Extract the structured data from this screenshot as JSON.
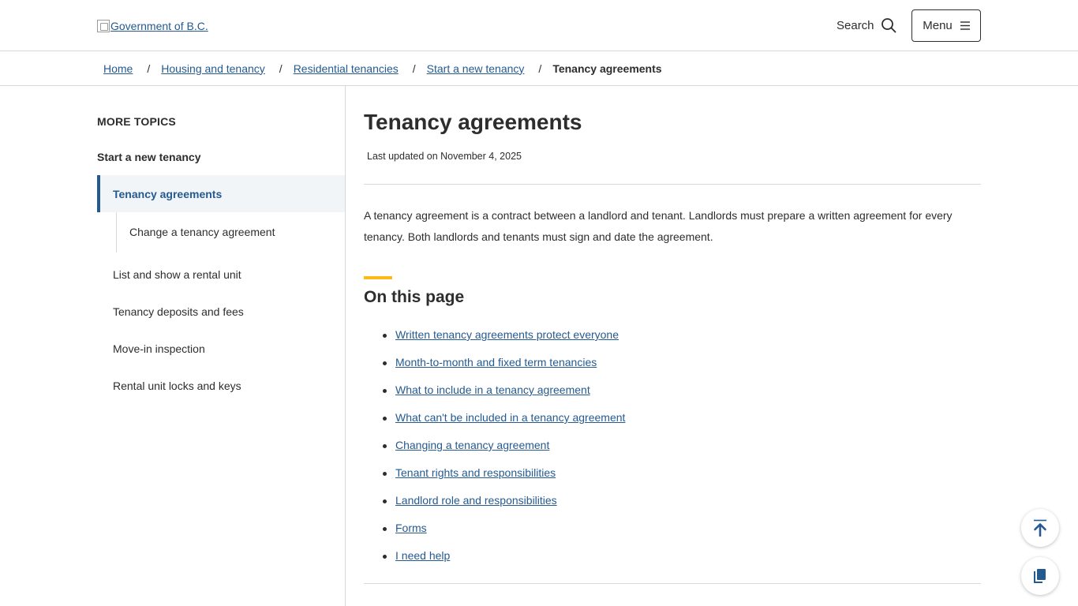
{
  "header": {
    "logo_alt": "Government of B.C.",
    "search_label": "Search",
    "menu_label": "Menu"
  },
  "breadcrumb": {
    "links": [
      "Home",
      "Housing and tenancy",
      "Residential tenancies",
      "Start a new tenancy"
    ],
    "separator": "/",
    "current": "Tenancy agreements"
  },
  "sidebar": {
    "heading": "MORE TOPICS",
    "parent": "Start a new tenancy",
    "active": "Tenancy agreements",
    "sub_item": "Change a tenancy agreement",
    "items": [
      "List and show a rental unit",
      "Tenancy deposits and fees",
      "Move-in inspection",
      "Rental unit locks and keys"
    ]
  },
  "main": {
    "title": "Tenancy agreements",
    "last_updated": "Last updated on November 4, 2025",
    "intro": "A tenancy agreement is a contract between a landlord and tenant. Landlords must prepare a written agreement for every tenancy. Both landlords and tenants must sign and date the agreement.",
    "on_this_page_heading": "On this page",
    "toc": [
      "Written tenancy agreements protect everyone",
      "Month-to-month and fixed term tenancies",
      "What to include in a tenancy agreement",
      "What can't be included in a tenancy agreement",
      "Changing a tenancy agreement",
      "Tenant rights and responsibilities",
      "Landlord role and responsibilities",
      "Forms",
      "I need help"
    ]
  },
  "floating": {
    "back_to_top_icon": "arrow-up-to-top-icon",
    "copy_icon": "copy-document-icon"
  },
  "colors": {
    "link": "#255a90",
    "text": "#2d2d2d",
    "accent": "#fcba19",
    "active_bg": "#f1f5f8",
    "border": "#d8d8d8"
  }
}
